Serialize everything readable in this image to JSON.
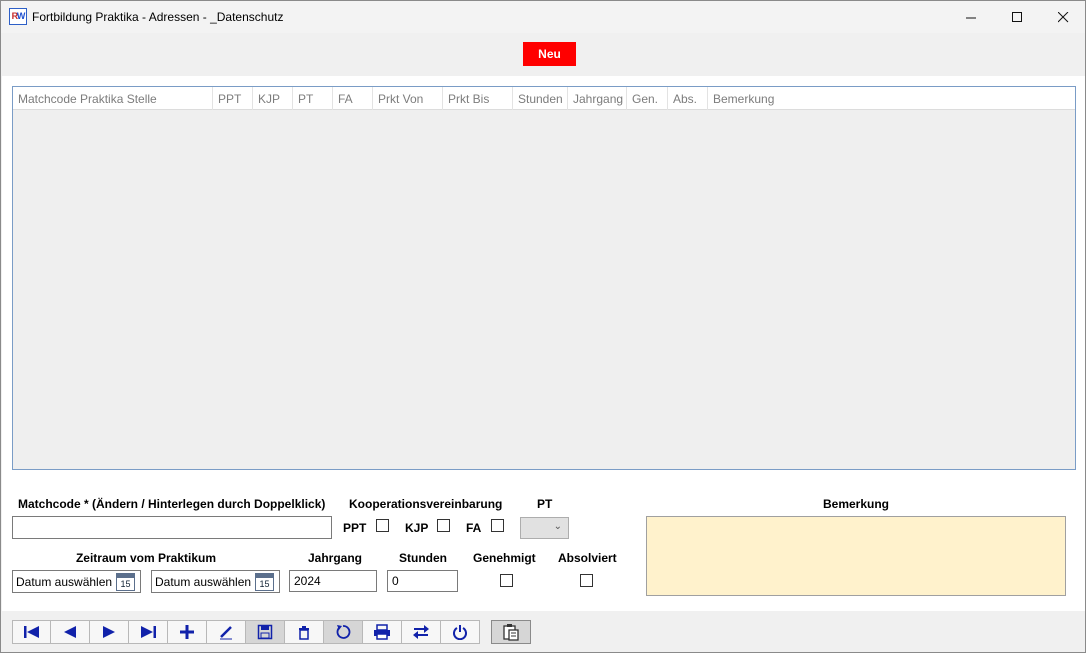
{
  "window": {
    "title": "Fortbildung Praktika - Adressen - _Datenschutz",
    "icon_text_a": "R",
    "icon_text_b": "W"
  },
  "neu_button": {
    "label": "Neu",
    "color": "#ff0000"
  },
  "grid": {
    "columns": [
      "Matchcode Praktika Stelle",
      "PPT",
      "KJP",
      "PT",
      "FA",
      "Prkt Von",
      "Prkt Bis",
      "Stunden",
      "Jahrgang",
      "Gen.",
      "Abs.",
      "Bemerkung"
    ],
    "rows": []
  },
  "form": {
    "matchcode_label": "Matchcode * (Ändern / Hinterlegen durch Doppelklick)",
    "matchcode_value": "",
    "kooperation_label": "Kooperationsvereinbarung",
    "ppt_label": "PPT",
    "kjp_label": "KJP",
    "fa_label": "FA",
    "pt_label": "PT",
    "pt_value": "",
    "zeitraum_label": "Zeitraum vom Praktikum",
    "date_from": "Datum auswählen",
    "date_to": "Datum auswählen",
    "calendar_day": "15",
    "jahrgang_label": "Jahrgang",
    "jahrgang_value": "2024",
    "stunden_label": "Stunden",
    "stunden_value": "0",
    "genehmigt_label": "Genehmigt",
    "absolviert_label": "Absolviert",
    "bemerkung_label": "Bemerkung",
    "bemerkung_value": "",
    "bemerkung_color": "#fff2cc"
  },
  "toolbar": {
    "buttons": [
      {
        "name": "first-record-icon",
        "glyph": "⏮"
      },
      {
        "name": "previous-record-icon",
        "glyph": "◀"
      },
      {
        "name": "next-record-icon",
        "glyph": "▶"
      },
      {
        "name": "last-record-icon",
        "glyph": "⏭"
      },
      {
        "name": "add-icon",
        "glyph": "+"
      },
      {
        "name": "edit-icon",
        "glyph": "✎"
      },
      {
        "name": "save-icon",
        "glyph": "💾"
      },
      {
        "name": "delete-icon",
        "glyph": "🗑"
      },
      {
        "name": "refresh-icon",
        "glyph": "↻"
      },
      {
        "name": "print-icon",
        "glyph": "🖶"
      },
      {
        "name": "swap-icon",
        "glyph": "⇄"
      },
      {
        "name": "power-icon",
        "glyph": "⏻"
      }
    ],
    "extra": {
      "name": "clipboard-icon",
      "glyph": "📋"
    }
  }
}
